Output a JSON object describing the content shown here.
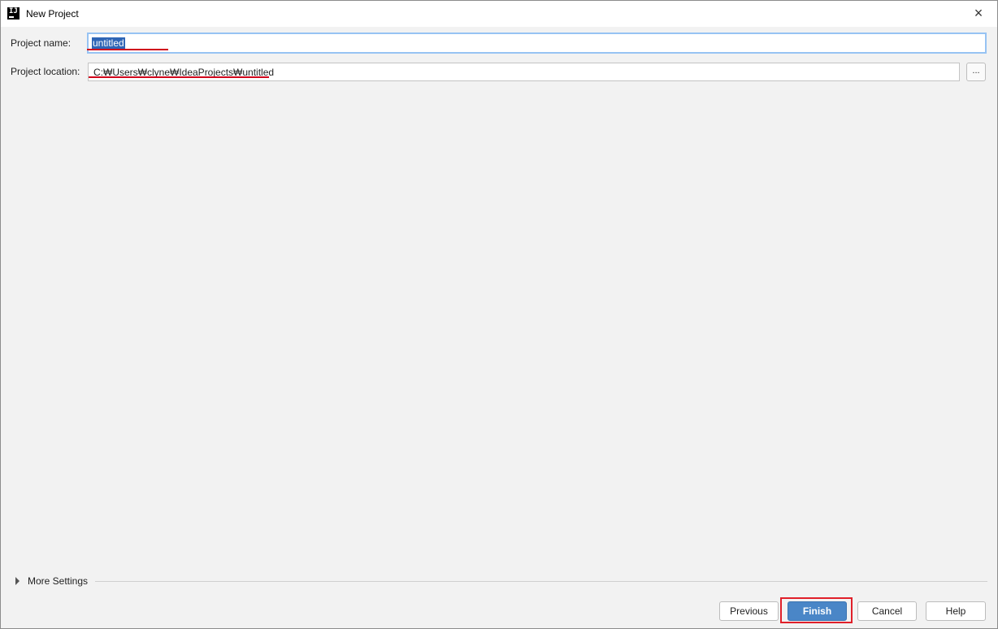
{
  "window": {
    "title": "New Project",
    "close_icon": "×"
  },
  "form": {
    "project_name_label": "Project name:",
    "project_name_value": "untitled",
    "project_location_label": "Project location:",
    "project_location_value": "C:₩Users₩clyne₩IdeaProjects₩untitled",
    "browse_label": "..."
  },
  "more_settings": {
    "label": "More Settings"
  },
  "buttons": {
    "previous": "Previous",
    "finish": "Finish",
    "cancel": "Cancel",
    "help": "Help"
  },
  "icons": {
    "app": "intellij-idea-icon",
    "close": "close-icon",
    "expand": "triangle-right-icon"
  },
  "colors": {
    "accent": "#4a86c7",
    "selection": "#2e65b6",
    "annotation_red": "#d0021b"
  }
}
